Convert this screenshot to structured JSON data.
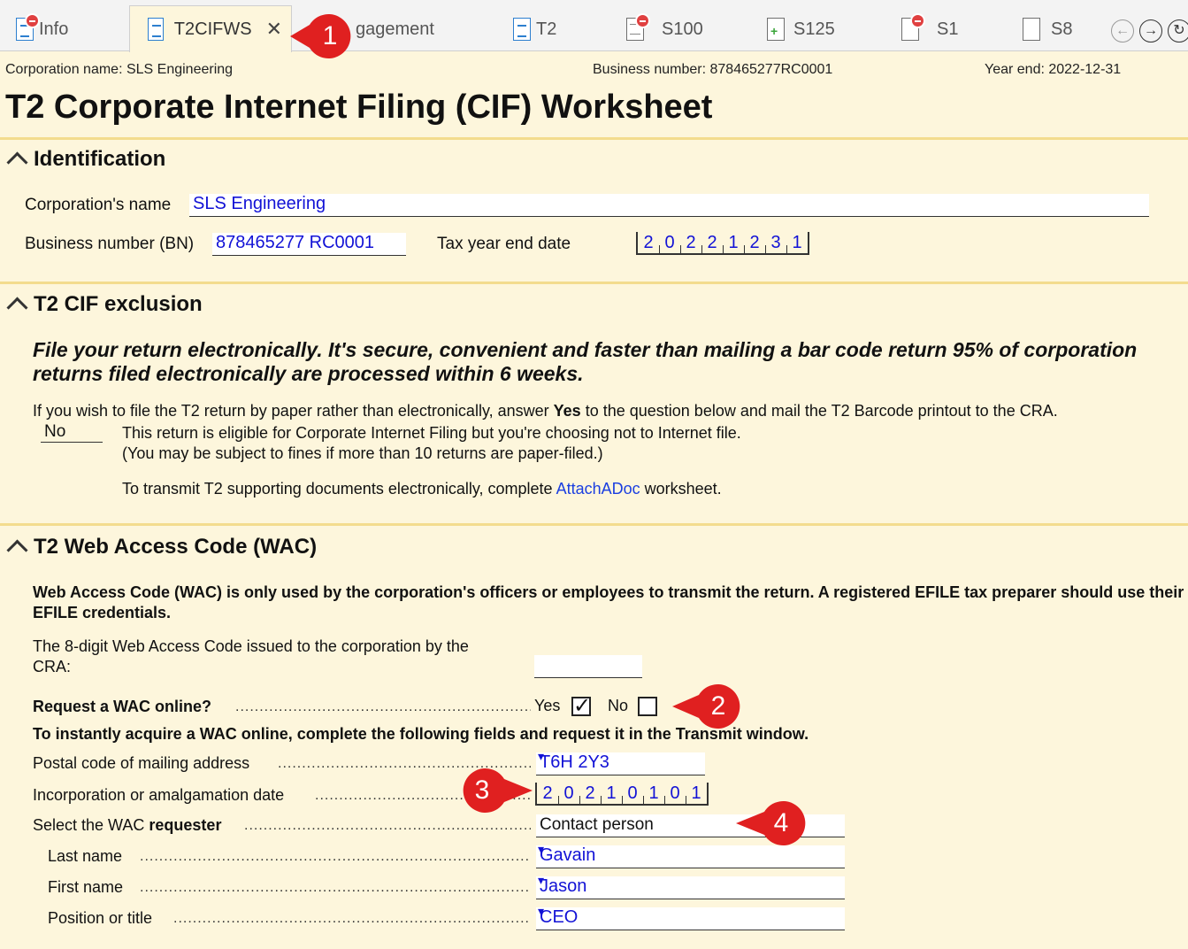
{
  "tabs": [
    {
      "label": "Info",
      "icon": "document-error-icon"
    },
    {
      "label": "T2CIFWS",
      "icon": "document-icon",
      "active": true
    },
    {
      "label": "gagement",
      "icon": "document-icon"
    },
    {
      "label": "T2",
      "icon": "document-icon"
    },
    {
      "label": "S100",
      "icon": "document-error-icon"
    },
    {
      "label": "S125",
      "icon": "document-add-icon"
    },
    {
      "label": "S1",
      "icon": "document-error-icon"
    },
    {
      "label": "S8",
      "icon": "document-icon"
    }
  ],
  "tab_close": "✕",
  "header": {
    "corporation_name": "Corporation name: SLS Engineering",
    "business_number": "Business number: 878465277RC0001",
    "year_end": "Year end: 2022-12-31"
  },
  "page_title": "T2 Corporate Internet Filing (CIF) Worksheet",
  "identification": {
    "heading": "Identification",
    "corp_name_label": "Corporation's name",
    "corp_name_value": "SLS Engineering",
    "bn_label": "Business number (BN)",
    "bn_value": "878465277 RC0001",
    "tax_year_end_label": "Tax year end date",
    "tax_year_end_digits": [
      "2",
      "0",
      "2",
      "2",
      "1",
      "2",
      "3",
      "1"
    ]
  },
  "exclusion": {
    "heading": "T2 CIF exclusion",
    "promo": "File your return electronically. It's secure, convenient and faster than mailing a bar code return 95% of corporation returns filed electronically are processed within 6 weeks.",
    "instruction_pre": "If you wish to file the T2 return by paper rather than electronically, answer",
    "instruction_bold": "Yes",
    "instruction_post": "to the question below and mail the T2 Barcode printout to the CRA.",
    "answer": "No",
    "eligible_text": "This return is eligible for Corporate Internet Filing but you're choosing not to Internet file.",
    "fines_text": "(You may be subject to fines if more than 10 returns are paper-filed.)",
    "attach_pre": "To transmit T2 supporting documents electronically, complete",
    "attach_link": "AttachADoc",
    "attach_post": "worksheet."
  },
  "wac": {
    "heading": "T2 Web Access Code (WAC)",
    "note": "Web Access Code (WAC) is only used by the corporation's officers or employees to transmit the return. A registered EFILE tax preparer should use their EFILE credentials.",
    "code_label_1": "The 8-digit Web Access Code issued to the corporation by the",
    "code_label_2": "CRA:",
    "request_label": "Request a WAC online?",
    "yes_label": "Yes",
    "yes_checked": true,
    "no_label": "No",
    "no_checked": false,
    "check_mark": "✓",
    "instant_note": "To instantly acquire a WAC online, complete the following fields and request it in the Transmit window.",
    "postal_label": "Postal code of mailing address",
    "postal_value": "T6H 2Y3",
    "incorp_label": "Incorporation or amalgamation date",
    "incorp_digits": [
      "2",
      "0",
      "2",
      "1",
      "0",
      "1",
      "0",
      "1"
    ],
    "requester_label_pre": "Select the WAC",
    "requester_label_bold": "requester",
    "requester_value": "Contact person",
    "last_name_label": "Last name",
    "last_name_value": "Gavain",
    "first_name_label": "First name",
    "first_name_value": "Jason",
    "position_label": "Position or title",
    "position_value": "CEO"
  },
  "callouts": [
    "1",
    "2",
    "3",
    "4"
  ],
  "callout_color": "#e02020"
}
